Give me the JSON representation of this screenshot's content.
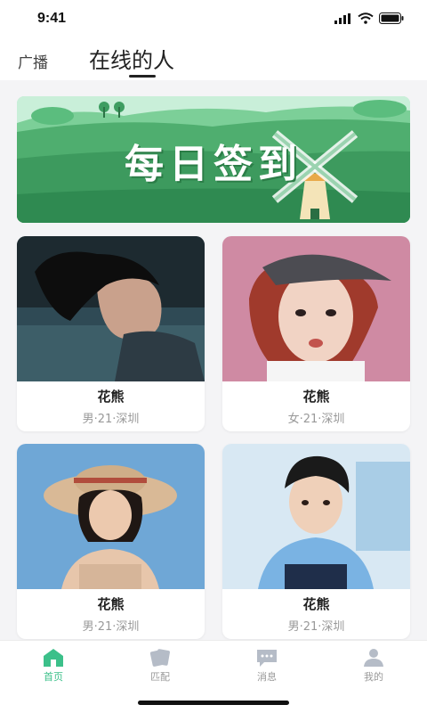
{
  "status_bar": {
    "time": "9:41"
  },
  "header": {
    "tabs": [
      {
        "label": "广播",
        "active": false
      },
      {
        "label": "在线的人",
        "active": true
      }
    ]
  },
  "banner": {
    "title": "每日签到"
  },
  "cards": [
    {
      "name": "花熊",
      "meta": "男·21·深圳"
    },
    {
      "name": "花熊",
      "meta": "女·21·深圳"
    },
    {
      "name": "花熊",
      "meta": "男·21·深圳"
    },
    {
      "name": "花熊",
      "meta": "男·21·深圳"
    }
  ],
  "bottom_nav": [
    {
      "label": "首页",
      "icon": "home-icon",
      "active": true
    },
    {
      "label": "匹配",
      "icon": "cards-icon",
      "active": false
    },
    {
      "label": "消息",
      "icon": "message-icon",
      "active": false
    },
    {
      "label": "我的",
      "icon": "profile-icon",
      "active": false
    }
  ],
  "colors": {
    "accent": "#3cc08a",
    "nav_inactive": "#b5bcc7",
    "banner_green": "#3d9a5e"
  }
}
